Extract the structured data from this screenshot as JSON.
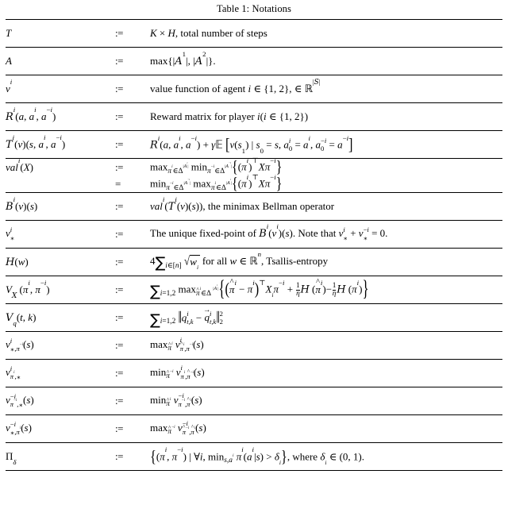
{
  "document": {
    "type": "academic-paper-table",
    "caption": "Table 1: Notations",
    "columns": [
      "symbol",
      "definition_operator",
      "description"
    ],
    "definition_operator": ":=",
    "equals_operator": "="
  },
  "rows": [
    {
      "symbol_plain": "T",
      "op": ":=",
      "desc_plain": "K × H, total number of steps"
    },
    {
      "symbol_plain": "A",
      "op": ":=",
      "desc_plain": "max{|A^1|, |A^2|}."
    },
    {
      "symbol_plain": "v^i",
      "op": ":=",
      "desc_plain": "value function of agent i ∈ {1, 2}, ∈ R^|S|"
    },
    {
      "symbol_plain": "R^i(a, a^i, a^-i)",
      "op": ":=",
      "desc_plain": "Reward matrix for player i(i ∈ {1, 2})"
    },
    {
      "symbol_plain": "T^i(v)(s, a^i, a^-i)",
      "op": ":=",
      "desc_plain": "R^i(a, a^i, a^-i) + γE[v(s_1) | s_0 = s, a_0^i = a^i, a_0^-i = a^-i]"
    },
    {
      "symbol_plain": "val^i(X)",
      "op": ":=",
      "desc_plain": "max_{π^i ∈ Δ^|A^i|} min_{π^-i ∈ Δ^|A^-i|} {(π^i)^T X π^-i}",
      "op2": "=",
      "desc2_plain": "min_{π^-i ∈ Δ^|A^-i|} max_{π^i ∈ Δ^|A^i|} {(π^i)^T X π^-i}"
    },
    {
      "symbol_plain": "B^i(v)(s)",
      "op": ":=",
      "desc_plain": "val^i(T^i(v)(s)), the minimax Bellman operator"
    },
    {
      "symbol_plain": "v^i_*",
      "op": ":=",
      "desc_plain": "The unique fixed-point of B^i(v^i)(s). Note that v^i_* + v^-i_* = 0."
    },
    {
      "symbol_plain": "H(w)",
      "op": ":=",
      "desc_plain": "4 Σ_{i∈[n]} sqrt(w_i) for all w ∈ R^n, Tsallis-entropy"
    },
    {
      "symbol_plain": "V_X(π^i, π^-i)",
      "op": ":=",
      "desc_plain": "Σ_{i=1,2} max_{π̂^i ∈ Δ^|A^i|} {(π̂^i − π^i)^T X_i π^-i + (1/η)H(π̂^i) − (1/η)H(π^i)}"
    },
    {
      "symbol_plain": "V_q(t, k)",
      "op": ":=",
      "desc_plain": "Σ_{i=1,2} ||q^i_{t,k} − q̄^i_{t,k}||_2^2"
    },
    {
      "symbol_plain": "v^i_{*, π^-i}(s)",
      "op": ":=",
      "desc_plain": "max_{π̂^i} v^i_{π̂^i, π^-i}(s)"
    },
    {
      "symbol_plain": "v^i_{π^i, *}",
      "op": ":=",
      "desc_plain": "min_{π̂^-i} v^i_{π^i, π̂^-i}(s)"
    },
    {
      "symbol_plain": "v^-i_{π^-i, *}(s)",
      "op": ":=",
      "desc_plain": "min_{π̂^i} v^-i_{π^-i, π̂^i}(s)"
    },
    {
      "symbol_plain": "v^-i_{*, π^i}(s)",
      "op": ":=",
      "desc_plain": "max_{π̂^-i} v^-i_{π̂^-i, π̂^i}(s)"
    },
    {
      "symbol_plain": "Π_δ",
      "op": ":=",
      "desc_plain": "{(π^i, π^-i) | ∀i, min_{s,a^i} π^i(a^i|s) > δ_i}, where δ_i ∈ (0, 1)."
    }
  ],
  "glyphs": {
    "times": "×",
    "in": "∈",
    "gamma": "γ",
    "pi": "π",
    "delta": "δ",
    "Delta": "Δ",
    "eta": "η",
    "Pi": "Π",
    "sum": "∑",
    "forall": "∀",
    "transpose": "⊤",
    "sqrt": "√",
    "blackboard_R": "ℝ",
    "blackboard_E": "𝔼",
    "minus": "−",
    "gt": ">",
    "star": "∗"
  }
}
